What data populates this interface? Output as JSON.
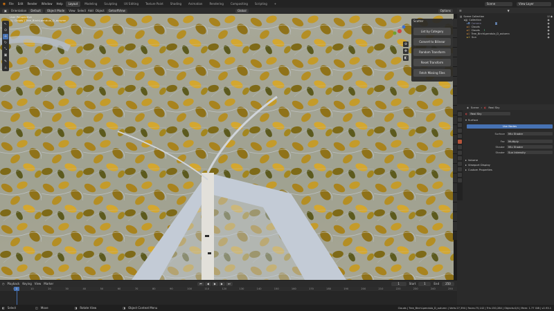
{
  "menu": [
    "File",
    "Edit",
    "Render",
    "Window",
    "Help"
  ],
  "workspaces": [
    "Layout",
    "Modeling",
    "Sculpting",
    "UV Editing",
    "Texture Paint",
    "Shading",
    "Animation",
    "Rendering",
    "Compositing",
    "Scripting"
  ],
  "top_right": {
    "scene": "Scene",
    "view_layer": "View Layer"
  },
  "viewport_header": {
    "orientation": "Orientation",
    "default": "Default",
    "object_mode": "Object Mode",
    "view": "View",
    "select": "Select",
    "add": "Add",
    "object": "Object",
    "gizmo_view": "GetsoftView",
    "transform": "Global",
    "options": "Options"
  },
  "viewport_info": [
    "User Perspective",
    "(1) Clouds | Tree_BirchLpendula_D_autumn"
  ],
  "npanel": {
    "title": "Scatter",
    "buttons": [
      "List by Category",
      "Convert to Bilinear",
      "Random Transform",
      "Reset Transform",
      "Fetch Missing Files"
    ]
  },
  "outliner": {
    "root": "Scene Collection",
    "rows": [
      "Collection",
      "Camera",
      "Clouds",
      "Clouds",
      "Tree_BirchLpendula_D_autumn",
      "Sun"
    ]
  },
  "properties": {
    "breadcrumb": [
      "Scene",
      "Real Sky"
    ],
    "world_name": "Real Sky",
    "section_surface": "Surface",
    "use_nodes": "Use Nodes",
    "fields": [
      {
        "label": "Surface",
        "value": "Mix Shader"
      },
      {
        "label": "Fac",
        "value": "Multiply"
      },
      {
        "label": "Shader",
        "value": "Mix Shader"
      },
      {
        "label": "Shader",
        "value": "Sun Intensity"
      }
    ],
    "sections": [
      "Volume",
      "Viewport Display",
      "Custom Properties"
    ]
  },
  "timeline": {
    "menus": [
      "Playback",
      "Keying",
      "View",
      "Marker"
    ],
    "current_frame": "1",
    "start_label": "Start",
    "start": "1",
    "end_label": "End",
    "end": "250",
    "ticks": [
      "0",
      "10",
      "20",
      "30",
      "40",
      "50",
      "60",
      "70",
      "80",
      "90",
      "100",
      "110",
      "120",
      "130",
      "140",
      "150",
      "160",
      "170",
      "180",
      "190",
      "200",
      "210",
      "220",
      "230",
      "240",
      "250"
    ]
  },
  "status": {
    "left": [
      "Select",
      "Move",
      "Rotate View",
      "Object Context Menu"
    ],
    "right": "Clouds | Tree_BirchLpendula_D_autumn | Verts:27,394 | Faces:75,142 | Tris:150,284 | Objects:0/4 | Mem: 1.77 GiB | v2.93.1"
  },
  "colors": {
    "accent": "#4772b3",
    "leaf": "#a07d1c",
    "leaf_dark": "#5d5a1a",
    "sky": "#c5ccd6"
  }
}
